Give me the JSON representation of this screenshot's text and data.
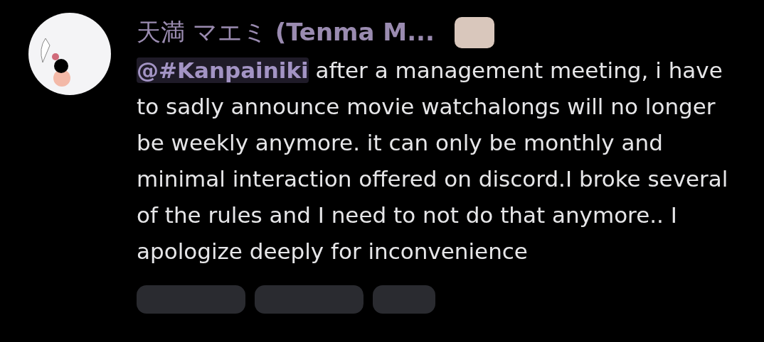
{
  "message": {
    "author": "天満 マエミ **(Tenma M...**",
    "mention": "@#Kanpainiki",
    "text": " after a management meeting, i have to sadly announce movie watchalongs will no longer be weekly anymore. it can only be monthly and minimal interaction offered on discord.I broke several of the rules and I need to not do that anymore.. I apologize deeply for inconvenience"
  }
}
